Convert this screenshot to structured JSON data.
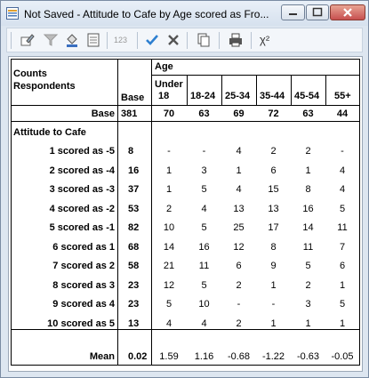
{
  "window": {
    "title": "Not Saved - Attitude to Cafe by Age scored as Fro...",
    "min_icon": "minimize-icon",
    "max_icon": "maximize-icon",
    "close_icon": "close-icon"
  },
  "toolbar": {
    "icons": [
      "edit-table-icon",
      "filter-icon",
      "fill-color-icon",
      "properties-icon",
      "decimal-places-icon",
      "checkmark-icon",
      "cancel-icon",
      "copy-icon",
      "print-icon",
      "chi-square-icon"
    ],
    "decimal_label": "123",
    "chi_label": "χ²"
  },
  "table": {
    "corner_line1": "Counts",
    "corner_line2": "Respondents",
    "base_header": "Base",
    "age_header": "Age",
    "age_columns": [
      {
        "line1": "Under",
        "line2": "18"
      },
      {
        "line1": "",
        "line2": "18-24"
      },
      {
        "line1": "",
        "line2": "25-34"
      },
      {
        "line1": "",
        "line2": "35-44"
      },
      {
        "line1": "",
        "line2": "45-54"
      },
      {
        "line1": "",
        "line2": "55+"
      }
    ],
    "base_row": {
      "label": "Base",
      "total": "381",
      "values": [
        "70",
        "63",
        "69",
        "72",
        "63",
        "44"
      ]
    },
    "section_label": "Attitude to Cafe",
    "rows": [
      {
        "label": "1 scored as -5",
        "total": "8",
        "values": [
          "-",
          "-",
          "4",
          "2",
          "2",
          "-"
        ]
      },
      {
        "label": "2 scored as -4",
        "total": "16",
        "values": [
          "1",
          "3",
          "1",
          "6",
          "1",
          "4"
        ]
      },
      {
        "label": "3 scored as -3",
        "total": "37",
        "values": [
          "1",
          "5",
          "4",
          "15",
          "8",
          "4"
        ]
      },
      {
        "label": "4 scored as -2",
        "total": "53",
        "values": [
          "2",
          "4",
          "13",
          "13",
          "16",
          "5"
        ]
      },
      {
        "label": "5 scored as -1",
        "total": "82",
        "values": [
          "10",
          "5",
          "25",
          "17",
          "14",
          "11"
        ]
      },
      {
        "label": "6 scored as 1",
        "total": "68",
        "values": [
          "14",
          "16",
          "12",
          "8",
          "11",
          "7"
        ]
      },
      {
        "label": "7 scored as 2",
        "total": "58",
        "values": [
          "21",
          "11",
          "6",
          "9",
          "5",
          "6"
        ]
      },
      {
        "label": "8 scored as 3",
        "total": "23",
        "values": [
          "12",
          "5",
          "2",
          "1",
          "2",
          "1"
        ]
      },
      {
        "label": "9 scored as 4",
        "total": "23",
        "values": [
          "5",
          "10",
          "-",
          "-",
          "3",
          "5"
        ]
      },
      {
        "label": "10 scored as 5",
        "total": "13",
        "values": [
          "4",
          "4",
          "2",
          "1",
          "1",
          "1"
        ]
      }
    ],
    "mean_row": {
      "label": "Mean",
      "total": "0.02",
      "values": [
        "1.59",
        "1.16",
        "-0.68",
        "-1.22",
        "-0.63",
        "-0.05"
      ]
    }
  }
}
